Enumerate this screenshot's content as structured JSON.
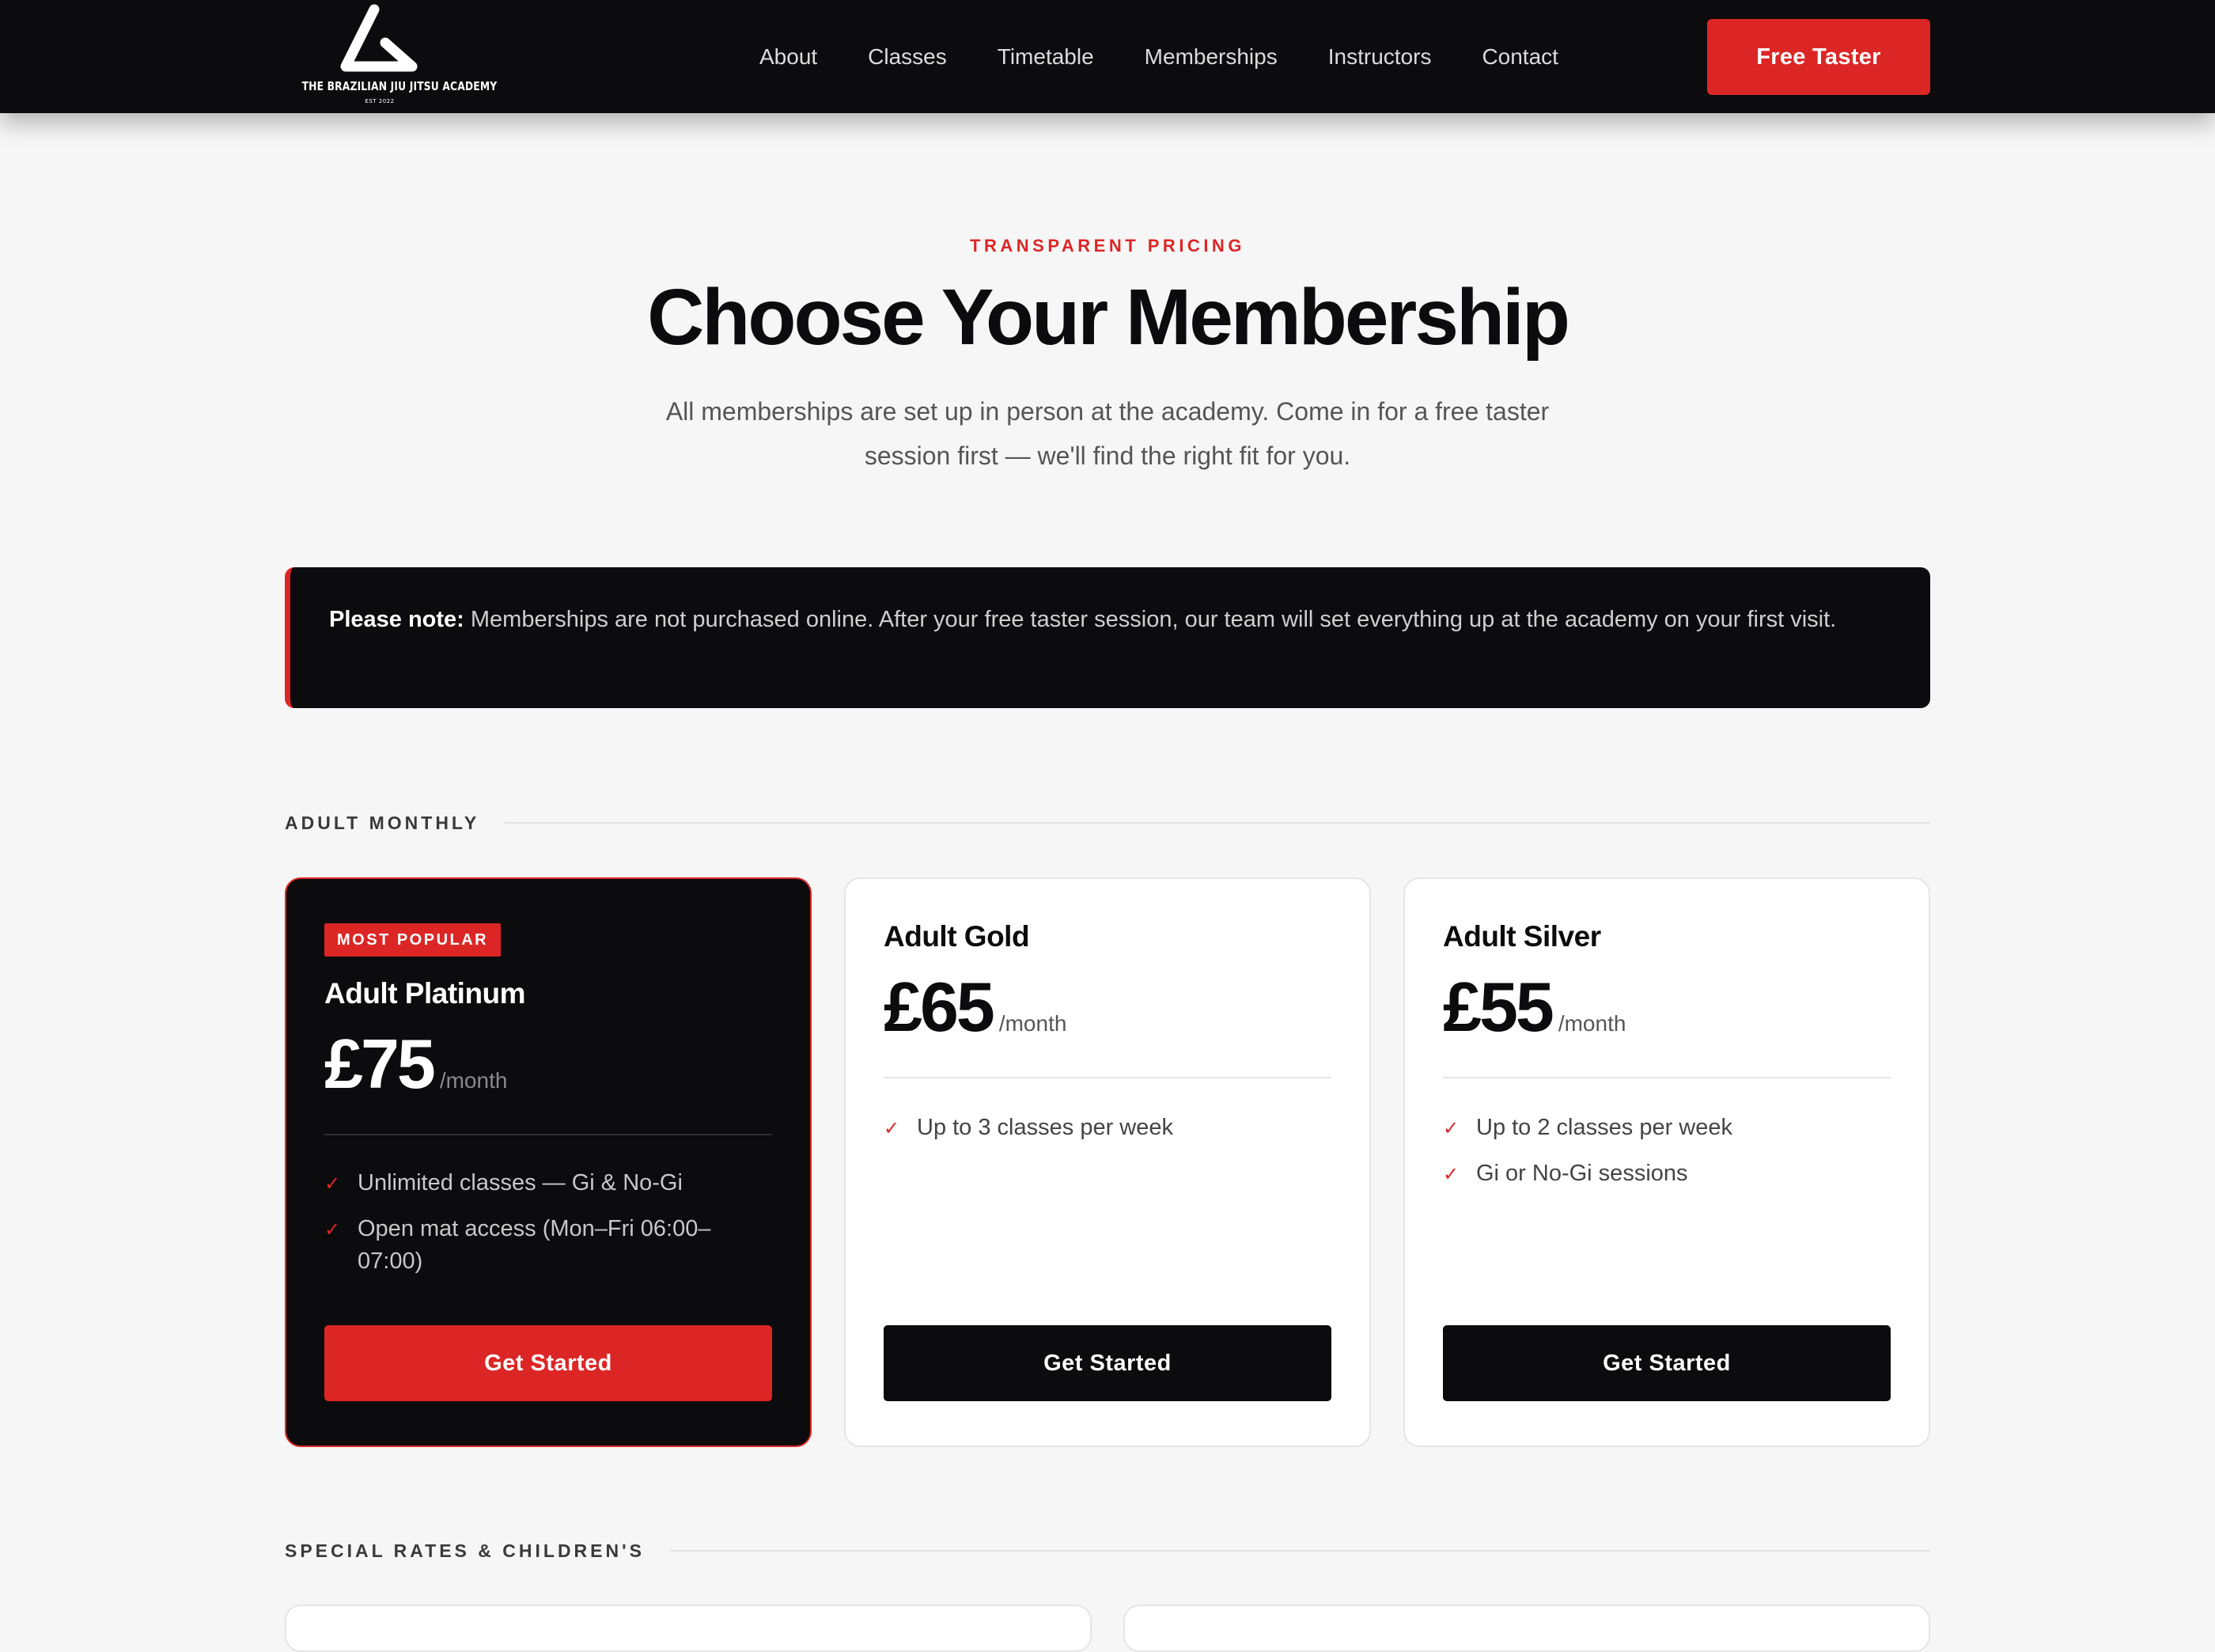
{
  "header": {
    "logo_name": "THE BRAZILIAN JIU JITSU ACADEMY",
    "logo_est": "EST 2022",
    "nav": [
      {
        "label": "About"
      },
      {
        "label": "Classes"
      },
      {
        "label": "Timetable"
      },
      {
        "label": "Memberships"
      },
      {
        "label": "Instructors"
      },
      {
        "label": "Contact"
      }
    ],
    "cta_label": "Free Taster"
  },
  "hero": {
    "eyebrow": "TRANSPARENT PRICING",
    "title": "Choose Your Membership",
    "subtitle": "All memberships are set up in person at the academy. Come in for a free taster session first — we'll find the right fit for you."
  },
  "note": {
    "strong": "Please note:",
    "text": " Memberships are not purchased online. After your free taster session, our team will set everything up at the academy on your first visit."
  },
  "sections": {
    "adult_monthly": "ADULT MONTHLY",
    "special": "SPECIAL RATES & CHILDREN'S"
  },
  "plans": [
    {
      "badge": "MOST POPULAR",
      "name": "Adult Platinum",
      "price": "£75",
      "period": "/month",
      "features": [
        "Unlimited classes — Gi & No-Gi",
        "Open mat access (Mon–Fri 06:00–07:00)"
      ],
      "button": "Get Started"
    },
    {
      "name": "Adult Gold",
      "price": "£65",
      "period": "/month",
      "features": [
        "Up to 3 classes per week"
      ],
      "button": "Get Started"
    },
    {
      "name": "Adult Silver",
      "price": "£55",
      "period": "/month",
      "features": [
        "Up to 2 classes per week",
        "Gi or No-Gi sessions"
      ],
      "button": "Get Started"
    }
  ],
  "colors": {
    "accent": "#dc2626",
    "dark": "#0c0b0d",
    "background": "#f6f6f6"
  },
  "icons": {
    "logo": "triangle-logo-icon",
    "feature_check": "check-icon"
  }
}
